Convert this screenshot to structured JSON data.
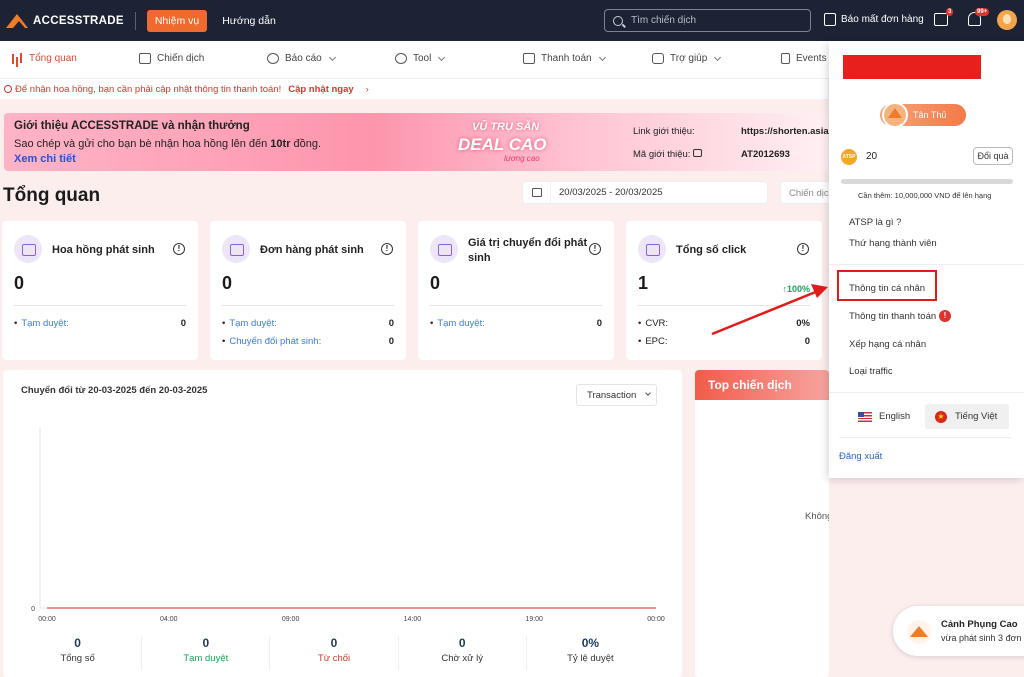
{
  "topbar": {
    "brand": "ACCESSTRADE",
    "mission_label": "Nhiệm vụ",
    "guide_label": "Hướng dẫn",
    "search_placeholder": "Tìm chiến dịch",
    "report_label": "Báo mất đơn hàng",
    "mail_badge": "3",
    "bell_badge": "99+"
  },
  "nav": [
    {
      "label": "Tổng quan",
      "icon": "bar-chart-icon",
      "active": true
    },
    {
      "label": "Chiến dịch",
      "icon": "grid-icon"
    },
    {
      "label": "Báo cáo",
      "icon": "pie-chart-icon"
    },
    {
      "label": "Tool",
      "icon": "gear-icon"
    },
    {
      "label": "Thanh toán",
      "icon": "wallet-icon"
    },
    {
      "label": "Trợ giúp",
      "icon": "help-icon"
    },
    {
      "label": "Events",
      "icon": "flag-icon"
    }
  ],
  "notice": {
    "text": "Để nhận hoa hồng, bạn cần phải cập nhật thông tin thanh toán!",
    "link": "Cập nhật ngay",
    "arrow": "›"
  },
  "banner": {
    "title": "Giới thiệu ACCESSTRADE và nhận thưởng",
    "desc_prefix": "Sao chép và gửi cho bạn bè nhận hoa hồng lên đến ",
    "desc_bold": "10tr",
    "desc_suffix": " đồng.",
    "link": "Xem chi tiết",
    "art_line1": "VŨ TRỤ SĂN",
    "art_line2": "DEAL CAO",
    "art_line3": "lương cao",
    "ref_link_label": "Link giới thiệu:",
    "ref_link_value": "https://shorten.asia/",
    "ref_code_label": "Mã giới thiệu:",
    "ref_code_value": "AT2012693"
  },
  "page_title": "Tổng quan",
  "date_range": "20/03/2025 - 20/03/2025",
  "campaign_filter": "Chiến dịch",
  "cards": [
    {
      "title": "Hoa hồng phát sinh",
      "value": "0",
      "rows": [
        {
          "k": "Tạm duyệt:",
          "v": "0"
        }
      ]
    },
    {
      "title": "Đơn hàng phát sinh",
      "value": "0",
      "rows": [
        {
          "k": "Tạm duyệt:",
          "v": "0"
        },
        {
          "k": "Chuyển đổi phát sinh:",
          "v": "0"
        }
      ]
    },
    {
      "title": "Giá trị chuyển đổi phát sinh",
      "value": "0",
      "rows": [
        {
          "k": "Tạm duyệt:",
          "v": "0"
        }
      ]
    },
    {
      "title": "Tổng số click",
      "value": "1",
      "badge": "↑100%",
      "rows": [
        {
          "k": "CVR:",
          "v": "0%"
        },
        {
          "k": "EPC:",
          "v": "0"
        }
      ]
    }
  ],
  "chart": {
    "title": "Chuyển đổi từ 20-03-2025 đến 20-03-2025",
    "select_value": "Transaction",
    "stats": [
      {
        "num": "0",
        "label": "Tổng số",
        "color": "#333333"
      },
      {
        "num": "0",
        "label": "Tạm duyệt",
        "color": "#1aa25a"
      },
      {
        "num": "0",
        "label": "Từ chối",
        "color": "#d0392e"
      },
      {
        "num": "0",
        "label": "Chờ xử lý",
        "color": "#333333"
      },
      {
        "num": "0%",
        "label": "Tỷ lệ duyệt",
        "color": "#333333"
      }
    ]
  },
  "chart_data": {
    "type": "line",
    "title": "Chuyển đổi từ 20-03-2025 đến 20-03-2025",
    "x": [
      "00:00",
      "04:00",
      "09:00",
      "14:00",
      "19:00",
      "00:00"
    ],
    "series": [
      {
        "values": [
          0,
          0,
          0,
          0,
          0,
          0
        ]
      }
    ],
    "y_ticks": [
      "0"
    ],
    "line_color": "#e0564a",
    "grid": false
  },
  "top_campaigns": {
    "title": "Top chiến dịch",
    "empty": "Không có dữ liệu để hiển thị!"
  },
  "dropdown": {
    "rank": "Tân Thủ",
    "atsp_coin": "ATSP",
    "atsp_points": "20",
    "gift_label": "Đổi quà",
    "progress": 0.0,
    "need_text": "Cần thêm: 10,000,000 VND để lên hạng",
    "items_a": [
      "ATSP là gì ?",
      "Thứ hạng thành viên"
    ],
    "items_b": [
      "Thông tin cá nhân",
      "Thông tin thanh toán",
      "Xếp hạng cá nhân",
      "Loại traffic"
    ],
    "alert": "!",
    "lang_en": "English",
    "lang_vi": "Tiếng Việt",
    "vn_star": "★",
    "logout": "Đăng xuất"
  },
  "toast": {
    "name": "Cảnh Phụng Cao",
    "message": "vừa phát sinh 3 đơn"
  },
  "colors": {
    "accent": "#ee6a2e",
    "highlight": "#e01b1b"
  }
}
